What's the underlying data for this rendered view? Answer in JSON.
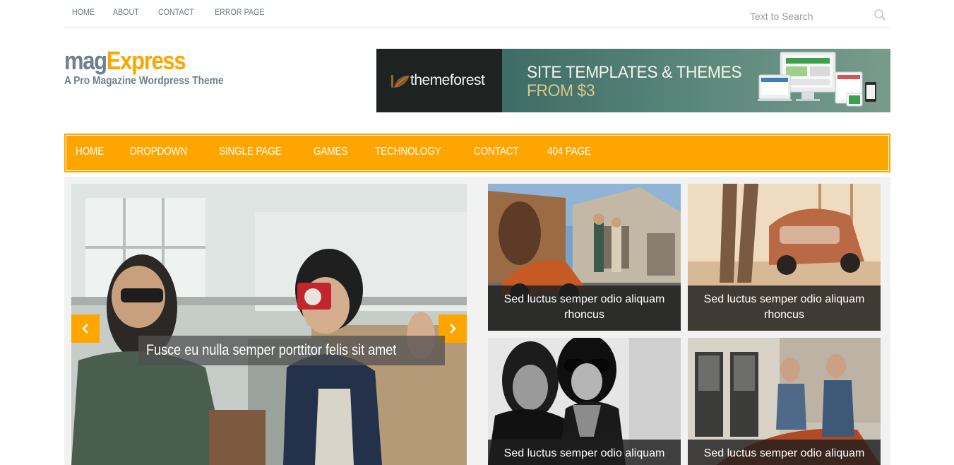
{
  "top_nav": {
    "items": [
      "HOME",
      "ABOUT",
      "CONTACT",
      "ERROR PAGE"
    ]
  },
  "search": {
    "placeholder": "Text to Search"
  },
  "logo": {
    "part1": "mag",
    "part2": "Express",
    "tagline": "A Pro Magazine Wordpress Theme"
  },
  "banner": {
    "brand": "themeforest",
    "line1": "SITE TEMPLATES & THEMES",
    "line2": "FROM $3"
  },
  "main_nav": {
    "items": [
      "HOME",
      "DROPDOWN",
      "SINGLE PAGE",
      "GAMES",
      "TECHNOLOGY",
      "CONTACT",
      "404 PAGE"
    ]
  },
  "slider": {
    "caption": "Fusce eu nulla semper porttitor felis sit amet",
    "prev_icon": "chevron-left-icon",
    "next_icon": "chevron-right-icon"
  },
  "featured": [
    {
      "caption": "Sed luctus semper odio aliquam rhoncus"
    },
    {
      "caption": "Sed luctus semper odio aliquam rhoncus"
    },
    {
      "caption": "Sed luctus semper odio aliquam"
    },
    {
      "caption": "Sed luctus semper odio aliquam"
    }
  ],
  "colors": {
    "accent": "#ffa500",
    "logo_gray": "#6e7f8d",
    "nav_text": "#ffffff"
  }
}
